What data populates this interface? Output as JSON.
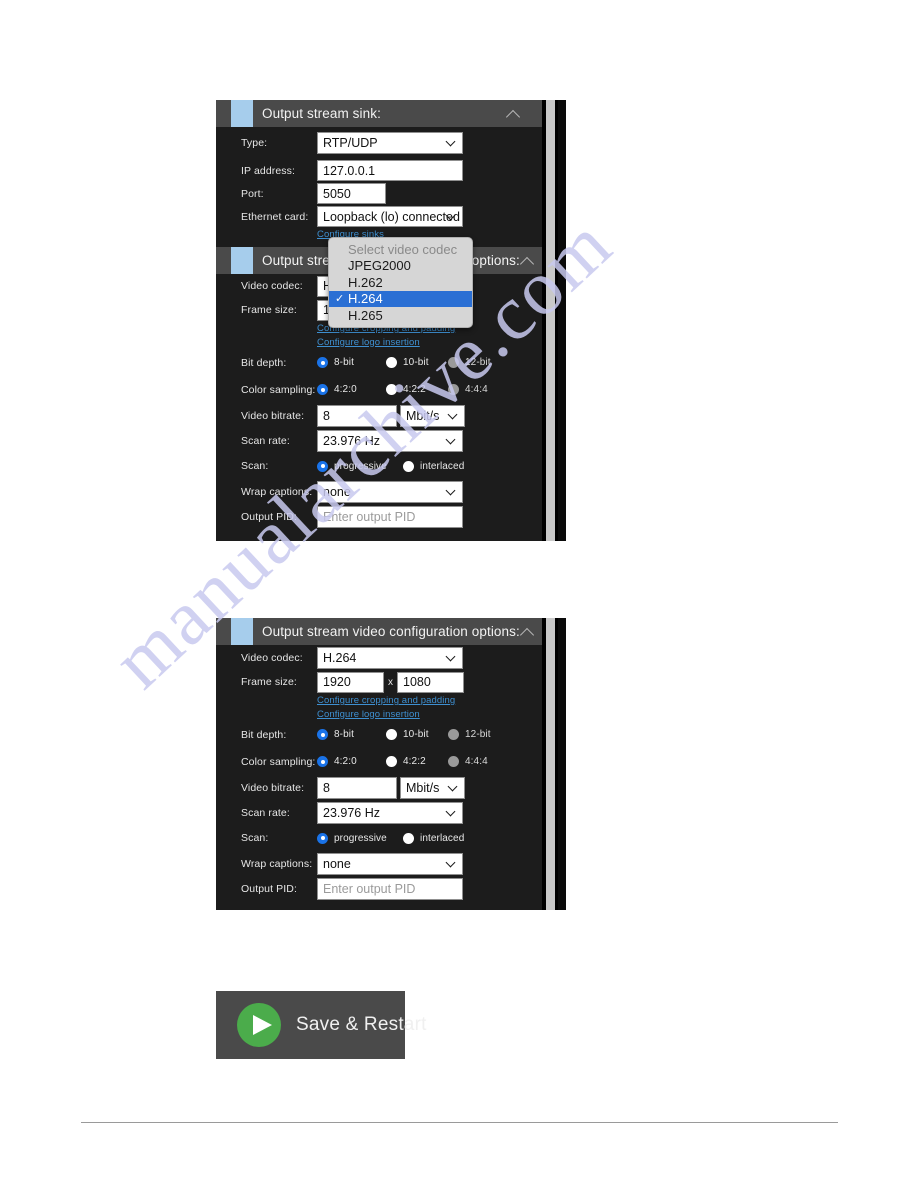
{
  "watermark": {
    "text": "manualarchive.com"
  },
  "panel_sink": {
    "header": {
      "title": "Output stream sink:",
      "collapse_icon": "chevron-up-icon"
    },
    "rows": [
      {
        "label": "Type:",
        "type": "select",
        "value": "RTP/UDP"
      },
      {
        "label": "IP address:",
        "type": "text",
        "value": "127.0.0.1"
      },
      {
        "label": "Port:",
        "type": "text",
        "value": "5050"
      },
      {
        "label": "Ethernet card:",
        "type": "select",
        "value": "Loopback (lo) connected"
      }
    ],
    "link": "Configure sinks"
  },
  "panel_video_1": {
    "header": {
      "title": "Output stream video configuration options:",
      "collapse_icon": "chevron-up-icon"
    },
    "video_codec": {
      "label": "Video codec:",
      "value": "H.264"
    },
    "frame_size": {
      "label": "Frame size:",
      "width": "1920",
      "separator": "x",
      "height": "1080"
    },
    "links": [
      "Configure cropping and padding",
      "Configure logo insertion"
    ],
    "bit_depth": {
      "label": "Bit depth:",
      "options": [
        {
          "label": "8-bit",
          "selected": true,
          "disabled": false
        },
        {
          "label": "10-bit",
          "selected": false,
          "disabled": false
        },
        {
          "label": "12-bit",
          "selected": false,
          "disabled": true
        }
      ]
    },
    "color_sampling": {
      "label": "Color sampling:",
      "options": [
        {
          "label": "4:2:0",
          "selected": true,
          "disabled": false
        },
        {
          "label": "4:2:2",
          "selected": false,
          "disabled": false
        },
        {
          "label": "4:4:4",
          "selected": false,
          "disabled": true
        }
      ]
    },
    "video_bitrate": {
      "label": "Video bitrate:",
      "value": "8",
      "unit": "Mbit/s"
    },
    "scan_rate": {
      "label": "Scan rate:",
      "value": "23.976 Hz"
    },
    "scan": {
      "label": "Scan:",
      "options": [
        {
          "label": "progressive",
          "selected": true
        },
        {
          "label": "interlaced",
          "selected": false
        }
      ]
    },
    "wrap_captions": {
      "label": "Wrap captions:",
      "value": "none"
    },
    "output_pid": {
      "label": "Output PID:",
      "placeholder": "Enter output PID",
      "value": ""
    }
  },
  "codec_dropdown": {
    "name": "video-codec-dropdown",
    "items": [
      {
        "label": "Select video codec",
        "state": "hint",
        "checked": false
      },
      {
        "label": "JPEG2000",
        "state": "normal",
        "checked": false
      },
      {
        "label": "H.262",
        "state": "normal",
        "checked": false
      },
      {
        "label": "H.264",
        "state": "selected",
        "checked": true
      },
      {
        "label": "H.265",
        "state": "normal",
        "checked": false
      }
    ],
    "check_glyph": "✓"
  },
  "panel_video_2": {
    "header": {
      "title": "Output stream video configuration options:",
      "collapse_icon": "chevron-up-icon"
    },
    "video_codec": {
      "label": "Video codec:",
      "value": "H.264"
    },
    "frame_size": {
      "label": "Frame size:",
      "width": "1920",
      "separator": "x",
      "height": "1080"
    },
    "links": [
      "Configure cropping and padding",
      "Configure logo insertion"
    ],
    "bit_depth": {
      "label": "Bit depth:",
      "options": [
        {
          "label": "8-bit",
          "selected": true,
          "disabled": false
        },
        {
          "label": "10-bit",
          "selected": false,
          "disabled": false
        },
        {
          "label": "12-bit",
          "selected": false,
          "disabled": true
        }
      ]
    },
    "color_sampling": {
      "label": "Color sampling:",
      "options": [
        {
          "label": "4:2:0",
          "selected": true,
          "disabled": false
        },
        {
          "label": "4:2:2",
          "selected": false,
          "disabled": false
        },
        {
          "label": "4:4:4",
          "selected": false,
          "disabled": true
        }
      ]
    },
    "video_bitrate": {
      "label": "Video bitrate:",
      "value": "8",
      "unit": "Mbit/s"
    },
    "scan_rate": {
      "label": "Scan rate:",
      "value": "23.976 Hz"
    },
    "scan": {
      "label": "Scan:",
      "options": [
        {
          "label": "progressive",
          "selected": true
        },
        {
          "label": "interlaced",
          "selected": false
        }
      ]
    },
    "wrap_captions": {
      "label": "Wrap captions:",
      "value": "none"
    },
    "output_pid": {
      "label": "Output PID:",
      "placeholder": "Enter output PID",
      "value": ""
    }
  },
  "save_button": {
    "label": "Save & Restart",
    "icon": "play-icon",
    "icon_color": "#4bac4b"
  },
  "colors": {
    "panel_bg": "#1c1c1c",
    "header_bg": "#4a4a4a",
    "marker": "#a6cdec",
    "accent_radio": "#1a73e8",
    "link": "#3e8fd0",
    "dropdown_selected": "#2a6fd4",
    "watermark": "#c8c9ef"
  }
}
